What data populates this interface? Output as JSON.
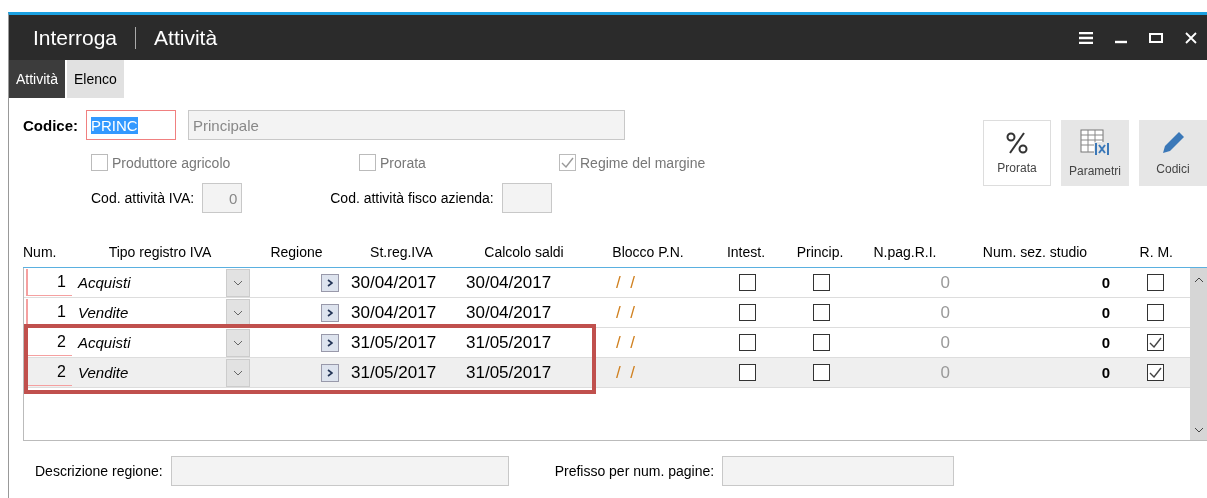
{
  "window": {
    "title_parts": [
      "Interroga",
      "Attività"
    ]
  },
  "tabs": [
    {
      "label": "Attività",
      "selected": true
    },
    {
      "label": "Elenco",
      "selected": false
    }
  ],
  "codice": {
    "label": "Codice:",
    "value": "PRINC",
    "description": "Principale"
  },
  "options": [
    {
      "label": "Produttore agricolo",
      "checked": false,
      "disabled": true
    },
    {
      "label": "Prorata",
      "checked": false,
      "disabled": true
    },
    {
      "label": "Regime del margine",
      "checked": true,
      "disabled": true
    }
  ],
  "cod_fields": [
    {
      "label": "Cod. attività IVA:",
      "value": "0"
    },
    {
      "label": "Cod. attività fisco azienda:"
    }
  ],
  "toolbar": [
    {
      "kind": "percent",
      "label": "Prorata",
      "selected": true
    },
    {
      "kind": "table",
      "label": "Parametri",
      "selected": false
    },
    {
      "kind": "pencil",
      "label": "Codici",
      "selected": false
    }
  ],
  "table": {
    "columns": [
      "Num.",
      "Tipo registro IVA",
      "Regione",
      "St.reg.IVA",
      "Calcolo saldi",
      "Blocco P.N.",
      "Intest.",
      "Princip.",
      "N.pag.R.I.",
      "Num. sez. studio",
      "R. M."
    ],
    "rows": [
      {
        "num": "1",
        "tipo": "Acquisti",
        "st_reg": "30/04/2017",
        "calcolo": "30/04/2017",
        "blocco": "/  /",
        "intest": false,
        "princip": false,
        "npag": "0",
        "num_sez": "0",
        "rm": false,
        "selected": false,
        "highlighted": false
      },
      {
        "num": "1",
        "tipo": "Vendite",
        "st_reg": "30/04/2017",
        "calcolo": "30/04/2017",
        "blocco": "/  /",
        "intest": false,
        "princip": false,
        "npag": "0",
        "num_sez": "0",
        "rm": false,
        "selected": false,
        "highlighted": false
      },
      {
        "num": "2",
        "tipo": "Acquisti",
        "st_reg": "31/05/2017",
        "calcolo": "31/05/2017",
        "blocco": "/  /",
        "intest": false,
        "princip": false,
        "npag": "0",
        "num_sez": "0",
        "rm": true,
        "selected": false,
        "highlighted": true
      },
      {
        "num": "2",
        "tipo": "Vendite",
        "st_reg": "31/05/2017",
        "calcolo": "31/05/2017",
        "blocco": "/  /",
        "intest": false,
        "princip": false,
        "npag": "0",
        "num_sez": "0",
        "rm": true,
        "selected": true,
        "highlighted": true
      }
    ]
  },
  "bottom_fields": [
    {
      "label": "Descrizione regione:"
    },
    {
      "label": "Prefisso per num. pagine:"
    }
  ]
}
